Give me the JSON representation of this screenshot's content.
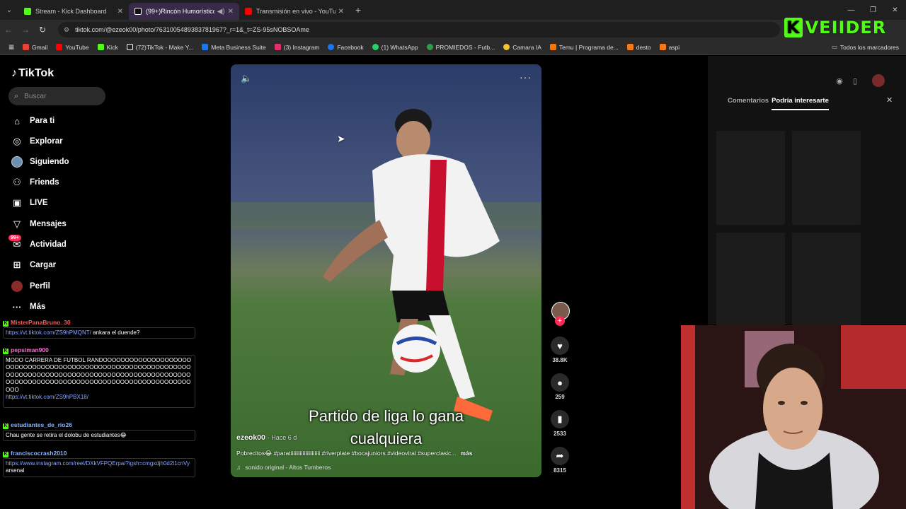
{
  "browser": {
    "tabs": [
      {
        "label": "Stream - Kick Dashboard",
        "color": "#53fc18"
      },
      {
        "label": "(99+)Rincón Humorístico d",
        "color": "#ffffff"
      },
      {
        "label": "Transmisión en vivo - YouTube",
        "color": "#ff0000"
      }
    ],
    "new_tab": "+",
    "url": "tiktok.com/@ezeok00/photo/7631005489383781967?_r=1&_t=ZS-95sNOBSOAme",
    "bookmarks": [
      {
        "label": "Gmail",
        "color": "#ea4335"
      },
      {
        "label": "YouTube",
        "color": "#ff0000"
      },
      {
        "label": "Kick",
        "color": "#53fc18"
      },
      {
        "label": "(72)TikTok - Make Y...",
        "color": "#ffffff"
      },
      {
        "label": "Meta Business Suite",
        "color": "#1877f2"
      },
      {
        "label": "(3) Instagram",
        "color": "#e1306c"
      },
      {
        "label": "Facebook",
        "color": "#1877f2"
      },
      {
        "label": "(1) WhatsApp",
        "color": "#25d366"
      },
      {
        "label": "PROMIEDOS - Futb...",
        "color": "#2e9e44"
      },
      {
        "label": "Camara IA",
        "color": "#f4c430"
      },
      {
        "label": "Temu | Programa de...",
        "color": "#fb7701"
      },
      {
        "label": "desto",
        "color": "#f77a1a"
      },
      {
        "label": "aspi",
        "color": "#f77a1a"
      }
    ],
    "bookmarks_right": "Todos los marcadores"
  },
  "overlay_logo": {
    "k": "K",
    "name": "VEIIDER"
  },
  "tiktok": {
    "brand": "TikTok",
    "search_placeholder": "Buscar",
    "nav": [
      {
        "label": "Para ti",
        "icon": "home-icon"
      },
      {
        "label": "Explorar",
        "icon": "compass-icon"
      },
      {
        "label": "Siguiendo",
        "icon": "following-avatar-icon"
      },
      {
        "label": "Friends",
        "icon": "friends-icon"
      },
      {
        "label": "LIVE",
        "icon": "live-icon"
      },
      {
        "label": "Mensajes",
        "icon": "messages-icon"
      },
      {
        "label": "Actividad",
        "icon": "activity-icon"
      },
      {
        "label": "Cargar",
        "icon": "upload-icon"
      },
      {
        "label": "Perfil",
        "icon": "profile-icon"
      },
      {
        "label": "Más",
        "icon": "more-icon"
      }
    ],
    "activity_badge": "99+",
    "video": {
      "caption_line1": "Partido de liga lo gana",
      "caption_line2": "cualquiera",
      "author": "ezeok00",
      "ago": "· Hace 6 d",
      "description": "Pobrecitos😂 #paratiiiiiiiiiiiiiiiiiiiiii #riverplate #bocajuniors #videoviral #superclasic...",
      "more": "más",
      "music": "sonido original - Altos Tumberos"
    },
    "actions": {
      "likes": "38.8K",
      "comments": "259",
      "saves": "2533",
      "shares": "8315"
    },
    "right_panel": {
      "tab_comments": "Comentarios",
      "tab_interest": "Podría interesarte"
    }
  },
  "chat": [
    {
      "user": "MisterPanaBruno_30",
      "user_color": "#ff5a5a",
      "text": "",
      "link": "https://vt.tiktok.com/ZS9hPMQNT/",
      "after": " ankara el duende?"
    },
    {
      "user": "pepsiman900",
      "user_color": "#ff6ad5",
      "text": "MODO CARRERA DE FUTBOL RANDOOOOOOOOOOOOOOOOOOOOOOOOOOOOOOOOOOOOOOOOOOOOOOOOOOOOOOOOOOOOOOOOOOOOOOOOOOOOOOOOOOOOOOOOOOOOOOOOOOOOOOOOOOOOOOOOOOOOOOOOOOOOOOOOOOOOOOOOOOOOOOOOOOOOO",
      "link": "https://vt.tiktok.com/ZS9hPBX18/",
      "after": ""
    },
    {
      "user": "estudiantes_de_rio26",
      "user_color": "#8ab4ff",
      "text": "Chau gente se retira el dolobu de estudiantes😂",
      "link": "",
      "after": ""
    },
    {
      "user": "franciscocrash2010",
      "user_color": "#8ab4ff",
      "text": "",
      "link": "https://www.instagram.com/reel/DXkVFPQErpa/?igsh=cmgxdjh0d2l1cnVy",
      "after": " arsenal"
    }
  ]
}
